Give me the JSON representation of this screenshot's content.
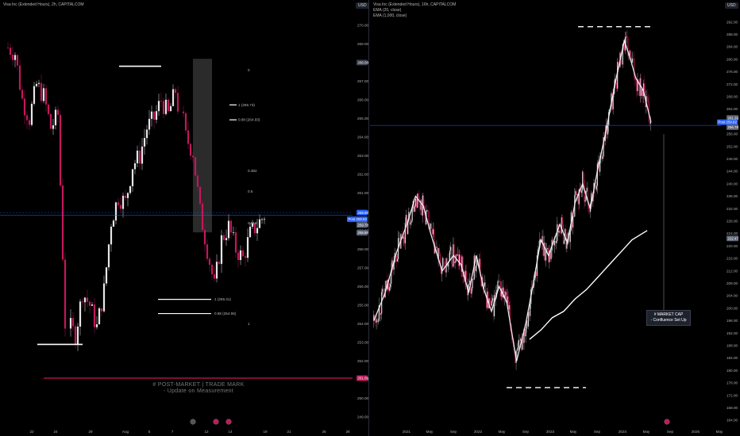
{
  "left": {
    "title": "Visa Inc (Extended Hours), 2h, CAPITALCOM",
    "currency": "USD",
    "price_axis": [
      "270.00",
      "269.00",
      "268.00",
      "267.00",
      "266.00",
      "265.00",
      "264.00",
      "263.00",
      "262.00",
      "261.00",
      "260.00",
      "259.00",
      "258.00",
      "257.00",
      "256.00",
      "255.00",
      "254.00",
      "253.00",
      "252.00",
      "251.00",
      "250.00",
      "249.00"
    ],
    "price_tags": [
      {
        "text": "268.00",
        "color": "#3a3f4b",
        "price": 268.0
      },
      {
        "text": "259.96",
        "color": "#2962ff",
        "price": 259.96
      },
      {
        "text": "Post  259.82",
        "color": "#2962ff",
        "price": 259.6
      },
      {
        "text": "259.78",
        "color": "#5b6275",
        "price": 259.3
      },
      {
        "text": "258.88",
        "color": "#5b6275",
        "price": 258.88
      },
      {
        "text": "251.09",
        "color": "#c2185b",
        "price": 251.09
      }
    ],
    "time_axis": [
      "22",
      "24",
      "29",
      "Aug",
      "5",
      "7",
      "12",
      "14",
      "19",
      "21",
      "26",
      "28"
    ],
    "fib_labels": [
      "0",
      "1 (265.73)",
      "0.88 (264.93)",
      "0.382",
      "0.5",
      "0.618",
      "1 (255.31)",
      "0.88 (254.55)",
      "1"
    ],
    "annotation_line1": "# POST-MARKET  |  TRADE MARK",
    "annotation_line2": "- Update on Measurement",
    "bottom_icons": [
      "lightning-icon",
      "earnings-icon",
      "dividend-icon"
    ]
  },
  "right": {
    "title": "Visa Inc (Extended Hours), 16h, CAPITALCOM",
    "legend": [
      "EMA (20, close)",
      "EMA (1,000, close)"
    ],
    "currency": "USD",
    "price_axis": [
      "292.00",
      "288.00",
      "284.00",
      "280.00",
      "276.00",
      "272.00",
      "268.00",
      "264.00",
      "260.00",
      "256.00",
      "252.00",
      "248.00",
      "244.00",
      "240.00",
      "236.00",
      "232.00",
      "228.00",
      "224.00",
      "220.00",
      "216.00",
      "212.00",
      "208.00",
      "204.00",
      "200.00",
      "196.00",
      "192.00",
      "188.00",
      "184.00",
      "180.00",
      "176.00",
      "172.00",
      "168.00",
      "164.00"
    ],
    "price_tags": [
      {
        "text": "261.20",
        "color": "#5b6275",
        "price": 261.2
      },
      {
        "text": "Post  259.82",
        "color": "#2962ff",
        "price": 259.82
      },
      {
        "text": "256.78",
        "color": "#5b6275",
        "price": 258.2
      },
      {
        "text": "222.47",
        "color": "#5b6275",
        "price": 222.47
      }
    ],
    "time_axis": [
      "2021",
      "May",
      "Sep",
      "2022",
      "May",
      "Sep",
      "2023",
      "May",
      "Sep",
      "2024",
      "May",
      "Sep",
      "2025",
      "May"
    ],
    "callout_line1": "# MARKET CAP",
    "callout_line2": "- Confluence Set Up"
  },
  "chart_data": [
    {
      "type": "candlestick",
      "title": "Visa Inc (Extended Hours), 2h, CAPITALCOM",
      "ylim": [
        248.5,
        270.5
      ],
      "x_ticks": [
        "22",
        "24",
        "29",
        "Aug",
        "5",
        "7",
        "12",
        "14",
        "19",
        "21",
        "26",
        "28"
      ],
      "close_path": [
        [
          0,
          268.8
        ],
        [
          3,
          268.5
        ],
        [
          6,
          266.0
        ],
        [
          9,
          265.0
        ],
        [
          12,
          266.8
        ],
        [
          15,
          266.2
        ],
        [
          18,
          264.5
        ],
        [
          21,
          265.2
        ],
        [
          24,
          254.0
        ],
        [
          27,
          253.4
        ],
        [
          30,
          255.7
        ],
        [
          33,
          255.0
        ],
        [
          36,
          253.8
        ],
        [
          39,
          255.8
        ],
        [
          42,
          259.5
        ],
        [
          45,
          260.8
        ],
        [
          48,
          260.5
        ],
        [
          51,
          262.5
        ],
        [
          54,
          263.0
        ],
        [
          57,
          264.5
        ],
        [
          60,
          265.0
        ],
        [
          63,
          266.0
        ],
        [
          66,
          265.2
        ],
        [
          69,
          266.5
        ],
        [
          72,
          264.0
        ],
        [
          75,
          263.2
        ],
        [
          78,
          260.0
        ],
        [
          81,
          258.0
        ],
        [
          84,
          256.0
        ],
        [
          87,
          258.5
        ],
        [
          90,
          259.2
        ],
        [
          93,
          258.0
        ],
        [
          96,
          257.5
        ],
        [
          99,
          258.8
        ],
        [
          102,
          259.3
        ],
        [
          105,
          259.82
        ]
      ],
      "fib_upper": {
        "0": 267.6,
        "1": 265.73,
        "0.88": 264.93,
        "0.382": 262.2,
        "0.5": 261.1,
        "0.618": 259.4
      },
      "fib_lower": {
        "1_a": 255.31,
        "0.88": 254.55,
        "1_b": 254.0
      },
      "swing_high": 267.8,
      "swing_low": 252.9,
      "highlight_zone": [
        258.9,
        268.2
      ],
      "post_market_mark": 251.09,
      "last_price": 259.82
    },
    {
      "type": "line",
      "title": "Visa Inc (Extended Hours), 16h, CAPITALCOM",
      "ylim": [
        162,
        294
      ],
      "x_ticks": [
        "2021",
        "May",
        "Sep",
        "2022",
        "May",
        "Sep",
        "2023",
        "May",
        "Sep",
        "2024",
        "May",
        "Sep",
        "2025",
        "May"
      ],
      "series": [
        {
          "name": "EMA (20, close)",
          "points": [
            [
              2020.9,
              196
            ],
            [
              2021.05,
              205
            ],
            [
              2021.2,
              218
            ],
            [
              2021.35,
              228
            ],
            [
              2021.45,
              236
            ],
            [
              2021.55,
              233
            ],
            [
              2021.65,
              224
            ],
            [
              2021.8,
              212
            ],
            [
              2021.95,
              217
            ],
            [
              2022.05,
              214
            ],
            [
              2022.15,
              205
            ],
            [
              2022.25,
              217
            ],
            [
              2022.35,
              206
            ],
            [
              2022.45,
              199
            ],
            [
              2022.55,
              207
            ],
            [
              2022.65,
              202
            ],
            [
              2022.78,
              183
            ],
            [
              2022.9,
              195
            ],
            [
              2023.0,
              208
            ],
            [
              2023.1,
              222
            ],
            [
              2023.2,
              217
            ],
            [
              2023.35,
              227
            ],
            [
              2023.45,
              221
            ],
            [
              2023.55,
              234
            ],
            [
              2023.65,
              240
            ],
            [
              2023.75,
              232
            ],
            [
              2023.85,
              245
            ],
            [
              2023.95,
              256
            ],
            [
              2024.1,
              275
            ],
            [
              2024.2,
              286
            ],
            [
              2024.28,
              280
            ],
            [
              2024.35,
              274
            ],
            [
              2024.45,
              270
            ],
            [
              2024.55,
              259.8
            ]
          ]
        },
        {
          "name": "EMA (1,000, close)",
          "points": [
            [
              2022.95,
              190
            ],
            [
              2023.1,
              193
            ],
            [
              2023.25,
              197
            ],
            [
              2023.4,
              199
            ],
            [
              2023.55,
              203
            ],
            [
              2023.7,
              206
            ],
            [
              2023.85,
              210
            ],
            [
              2024.0,
              214
            ],
            [
              2024.15,
              218
            ],
            [
              2024.3,
              222
            ],
            [
              2024.5,
              225
            ]
          ]
        }
      ],
      "resistance_level": 290.5,
      "support_level": 174.5,
      "last_price": 259.82
    }
  ]
}
